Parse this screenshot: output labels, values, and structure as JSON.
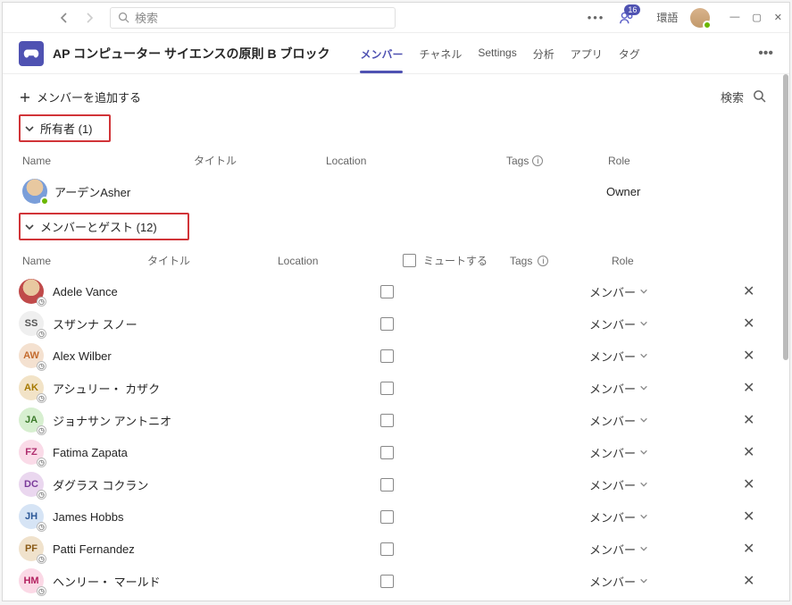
{
  "search_placeholder": "検索",
  "activity_count": "16",
  "lang_label": "環語",
  "team_name": "AP コンピューター サイエンスの原則 B ブロック",
  "tabs": {
    "members": "メンバー",
    "channels": "チャネル",
    "settings": "Settings",
    "analytics": "分析",
    "apps": "アプリ",
    "tags": "タグ"
  },
  "toolbar": {
    "add_member": "メンバーを追加する",
    "search_members": "検索"
  },
  "sections": {
    "owners_label": "所有者 (1)",
    "members_label": "メンバーとゲスト (12)"
  },
  "owner_columns": {
    "name": "Name",
    "title": "タイトル",
    "location": "Location",
    "tags": "Tags",
    "role": "Role"
  },
  "member_columns": {
    "name": "Name",
    "title": "タイトル",
    "location": "Location",
    "mute": "ミュートする",
    "tags": "Tags",
    "role": "Role"
  },
  "owner": {
    "name": "アーデンAsher",
    "role": "Owner"
  },
  "role_member": "メンバー",
  "members": [
    {
      "initials": "",
      "name": "Adele Vance",
      "av": "av-adele"
    },
    {
      "initials": "SS",
      "name": "スザンナ スノー",
      "av": "av-ss"
    },
    {
      "initials": "AW",
      "name": "Alex Wilber",
      "av": "av-aw"
    },
    {
      "initials": "AK",
      "name": "アシュリー・ カザク",
      "av": "av-ak"
    },
    {
      "initials": "JA",
      "name": "ジョナサン アントニオ",
      "av": "av-ja"
    },
    {
      "initials": "FZ",
      "name": "Fatima Zapata",
      "av": "av-fz"
    },
    {
      "initials": "DC",
      "name": "ダグラス コクラン",
      "av": "av-dc"
    },
    {
      "initials": "JH",
      "name": "James Hobbs",
      "av": "av-jh"
    },
    {
      "initials": "PF",
      "name": "Patti Fernandez",
      "av": "av-pf"
    },
    {
      "initials": "HM",
      "name": "ヘンリー・ マールド",
      "av": "av-hm"
    }
  ]
}
